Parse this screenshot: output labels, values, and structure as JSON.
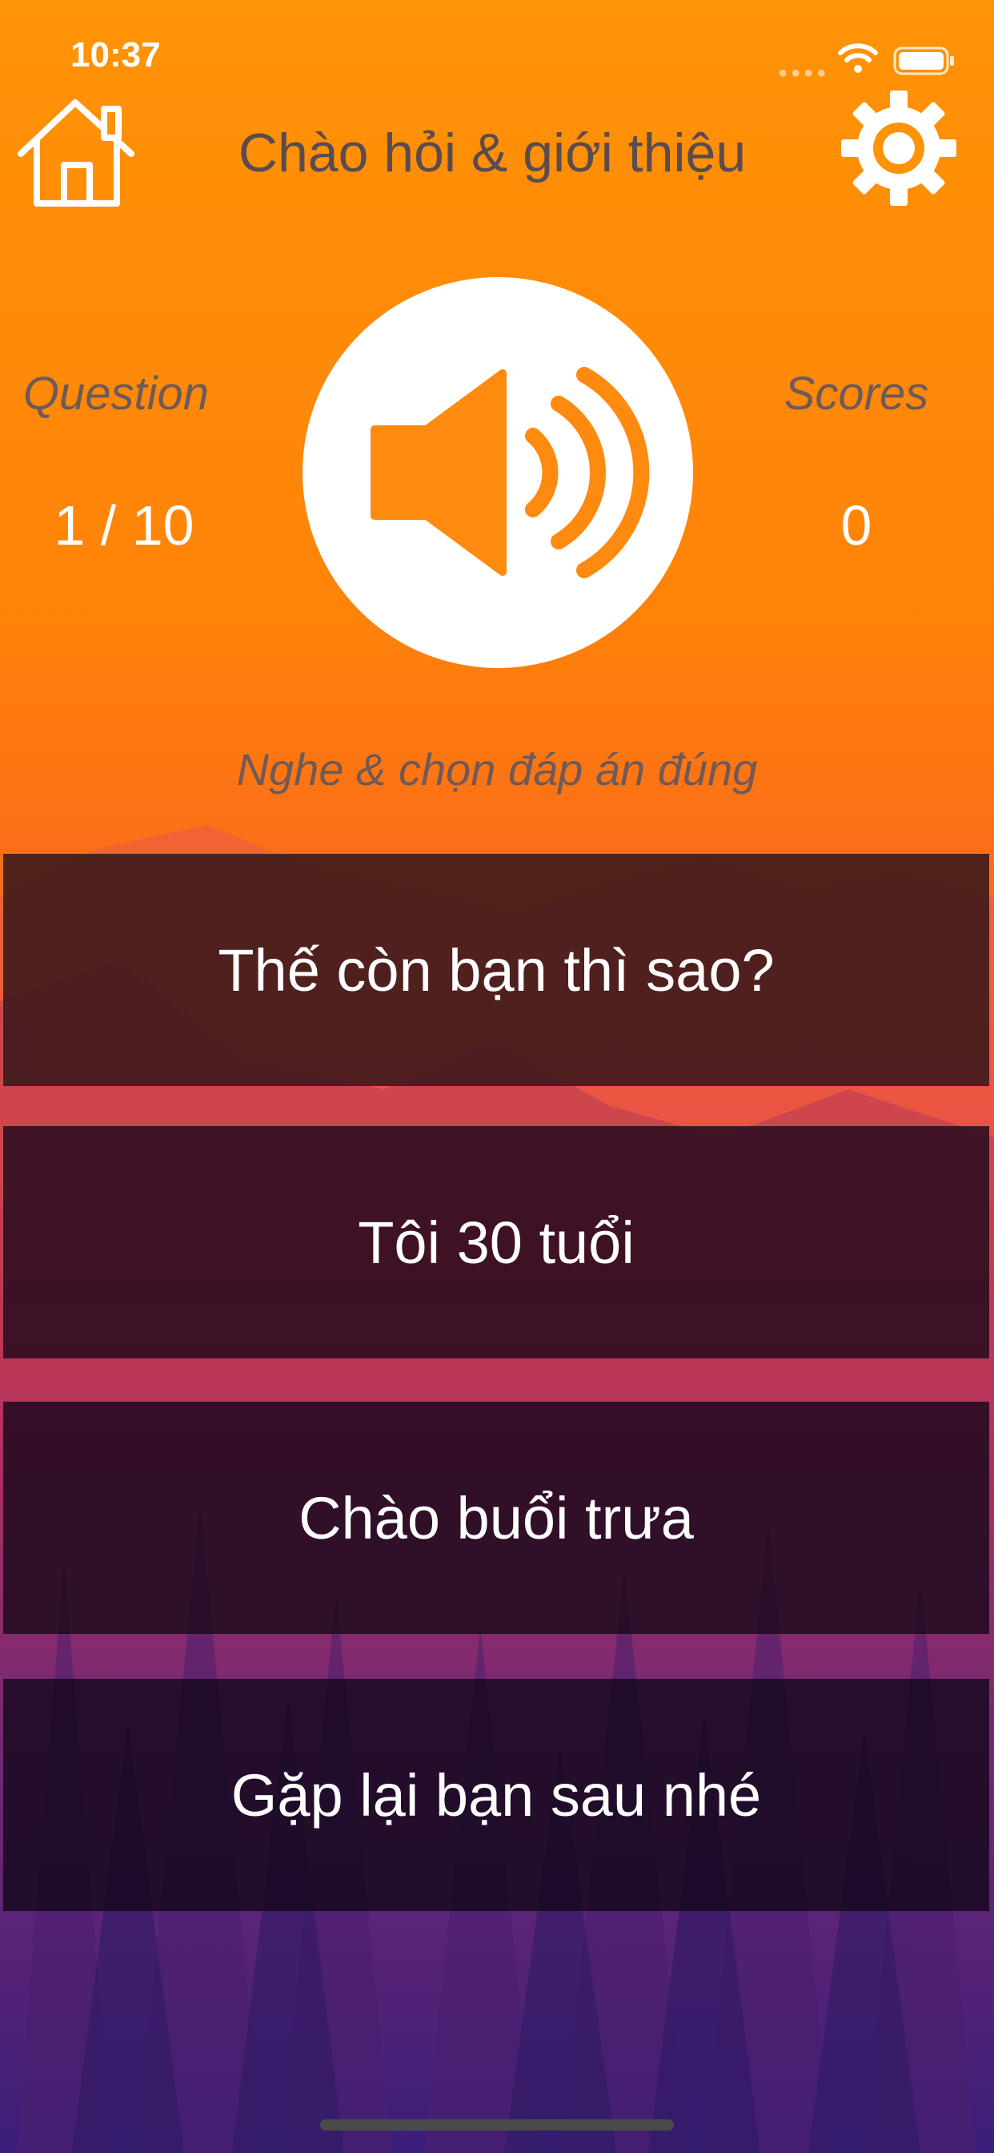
{
  "status_bar": {
    "time": "10:37"
  },
  "header": {
    "title": "Chào hỏi & giới thiệu",
    "home_icon": "home-icon",
    "settings_icon": "gear-icon"
  },
  "stats": {
    "question_label": "Question",
    "question_value": "1 / 10",
    "scores_label": "Scores",
    "scores_value": "0"
  },
  "player": {
    "icon": "speaker-icon"
  },
  "instruction": "Nghe & chọn đáp án đúng",
  "answers": [
    {
      "label": "Thế còn bạn thì sao?"
    },
    {
      "label": "Tôi 30 tuổi"
    },
    {
      "label": "Chào buổi trưa"
    },
    {
      "label": "Gặp lại bạn sau nhé"
    }
  ],
  "colors": {
    "background_top": "#FF9307",
    "background_mid": "#F04C3C",
    "background_bottom": "#3A1E7A",
    "speaker_accent": "#FF8A10",
    "title_text": "#5A4B50"
  }
}
